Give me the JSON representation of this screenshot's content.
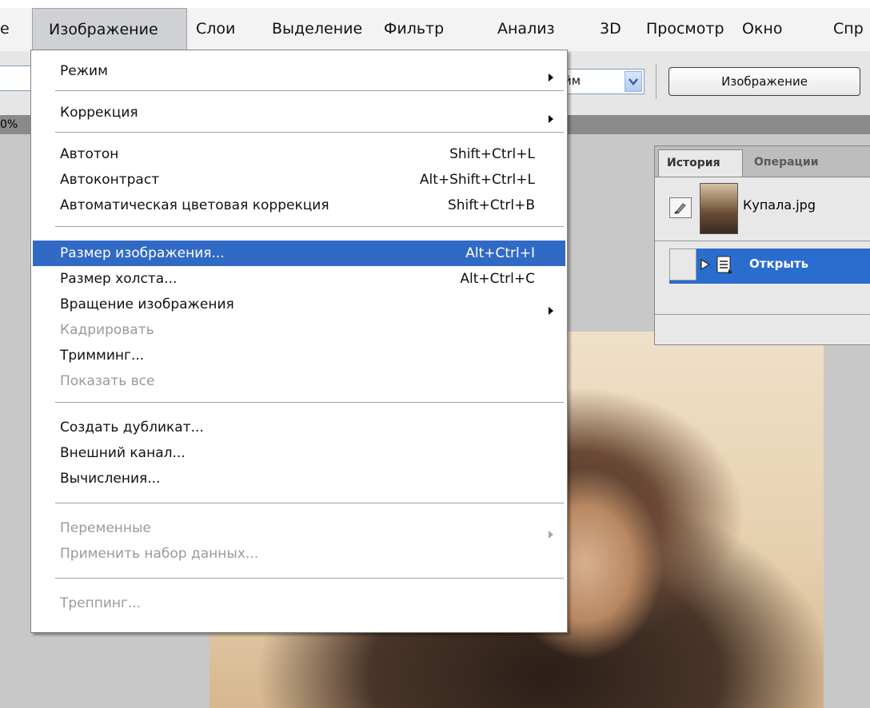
{
  "menubar": {
    "items": [
      {
        "label": "е"
      },
      {
        "label": "Изображение"
      },
      {
        "label": "Слои"
      },
      {
        "label": "Выделение"
      },
      {
        "label": "Фильтр"
      },
      {
        "label": "Анализ"
      },
      {
        "label": "3D"
      },
      {
        "label": "Просмотр"
      },
      {
        "label": "Окно"
      },
      {
        "label": "Спр"
      }
    ]
  },
  "options_bar": {
    "select_value": "йм",
    "button_label": "Изображение",
    "zoom_fragment": "0%"
  },
  "image_menu": {
    "rows": [
      {
        "label": "Режим",
        "shortcut": "",
        "submenu": true,
        "disabled": false,
        "highlighted": false
      },
      {
        "label": "Коррекция",
        "shortcut": "",
        "submenu": true,
        "disabled": false,
        "highlighted": false
      },
      {
        "label": "Автотон",
        "shortcut": "Shift+Ctrl+L",
        "submenu": false,
        "disabled": false,
        "highlighted": false
      },
      {
        "label": "Автоконтраст",
        "shortcut": "Alt+Shift+Ctrl+L",
        "submenu": false,
        "disabled": false,
        "highlighted": false
      },
      {
        "label": "Автоматическая цветовая коррекция",
        "shortcut": "Shift+Ctrl+B",
        "submenu": false,
        "disabled": false,
        "highlighted": false
      },
      {
        "label": "Размер изображения...",
        "shortcut": "Alt+Ctrl+I",
        "submenu": false,
        "disabled": false,
        "highlighted": true
      },
      {
        "label": "Размер холста...",
        "shortcut": "Alt+Ctrl+C",
        "submenu": false,
        "disabled": false,
        "highlighted": false
      },
      {
        "label": "Вращение изображения",
        "shortcut": "",
        "submenu": true,
        "disabled": false,
        "highlighted": false
      },
      {
        "label": "Кадрировать",
        "shortcut": "",
        "submenu": false,
        "disabled": true,
        "highlighted": false
      },
      {
        "label": "Тримминг...",
        "shortcut": "",
        "submenu": false,
        "disabled": false,
        "highlighted": false
      },
      {
        "label": "Показать все",
        "shortcut": "",
        "submenu": false,
        "disabled": true,
        "highlighted": false
      },
      {
        "label": "Создать дубликат...",
        "shortcut": "",
        "submenu": false,
        "disabled": false,
        "highlighted": false
      },
      {
        "label": "Внешний канал...",
        "shortcut": "",
        "submenu": false,
        "disabled": false,
        "highlighted": false
      },
      {
        "label": "Вычисления...",
        "shortcut": "",
        "submenu": false,
        "disabled": false,
        "highlighted": false
      },
      {
        "label": "Переменные",
        "shortcut": "",
        "submenu": true,
        "disabled": true,
        "highlighted": false
      },
      {
        "label": "Применить набор данных...",
        "shortcut": "",
        "submenu": false,
        "disabled": true,
        "highlighted": false
      },
      {
        "label": "Треппинг...",
        "shortcut": "",
        "submenu": false,
        "disabled": true,
        "highlighted": false
      }
    ]
  },
  "history_panel": {
    "tabs": [
      {
        "label": "История",
        "active": true
      },
      {
        "label": "Операции",
        "active": false
      }
    ],
    "snapshot_label": "Купала.jpg",
    "state_label": "Открыть"
  },
  "colors": {
    "menu_highlight": "#316ac5",
    "history_selected": "#2b6ccf"
  }
}
